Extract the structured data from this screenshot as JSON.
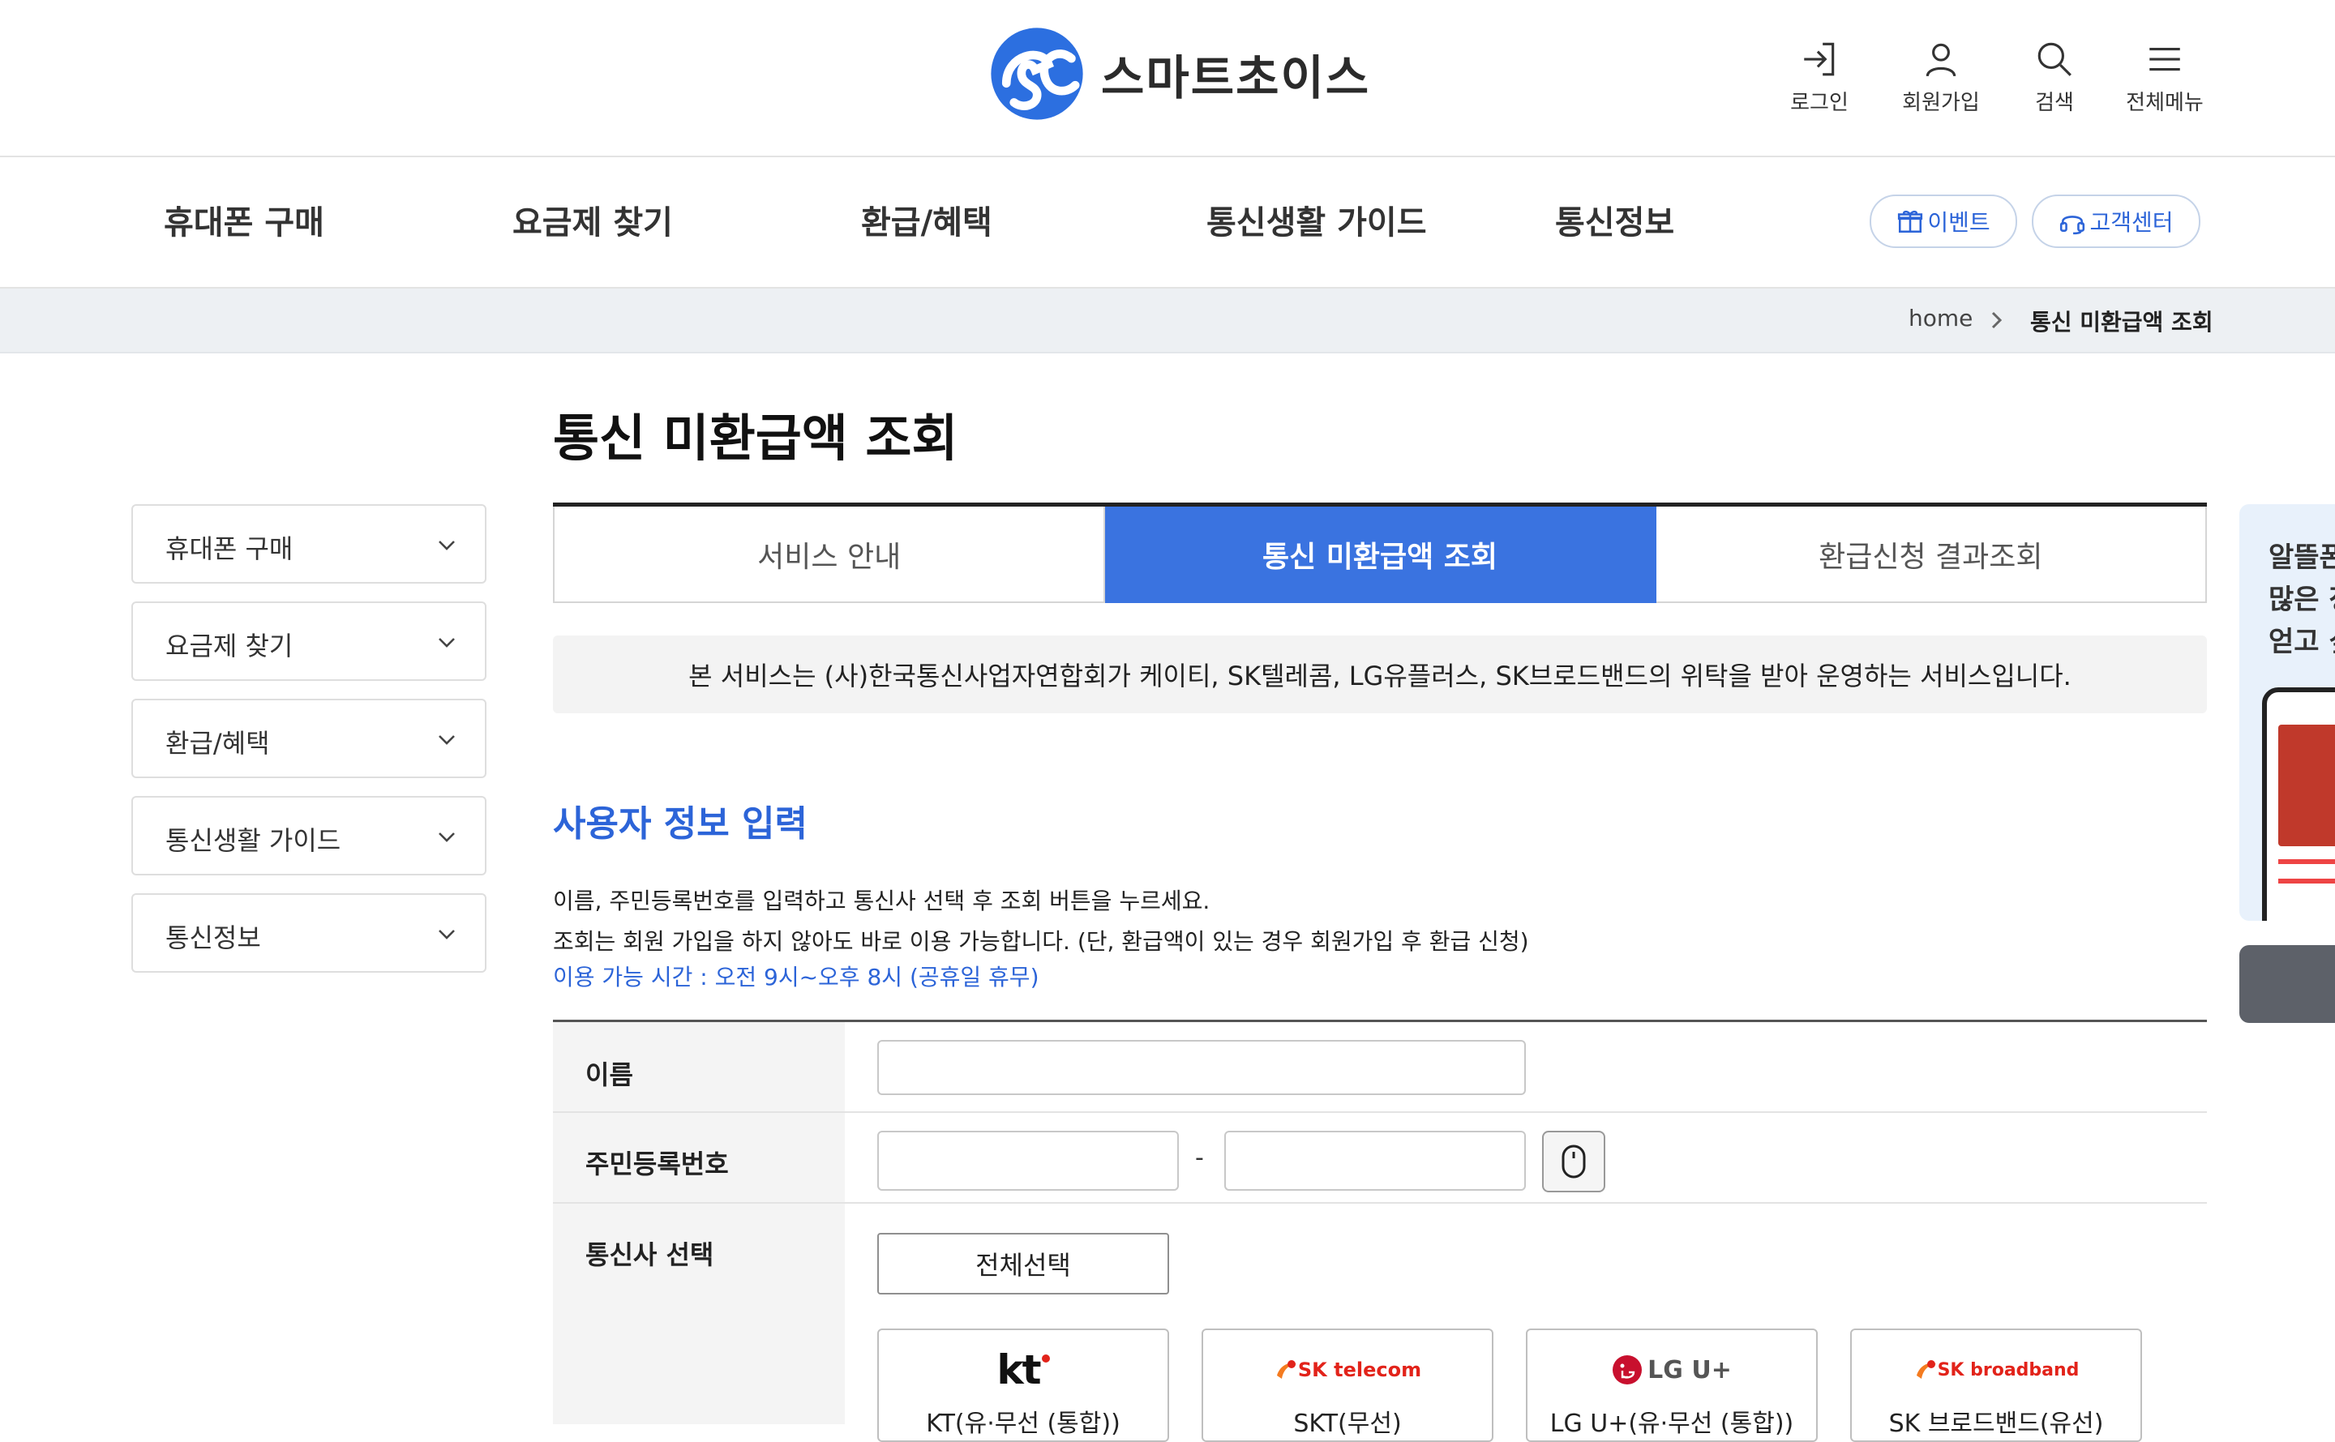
{
  "header": {
    "brand": "스마트초이스",
    "brand_colors": {
      "blue": "#2c6fe0",
      "dark_blue": "#1d4fb8"
    },
    "utility": [
      {
        "icon": "login-icon",
        "label": "로그인"
      },
      {
        "icon": "user-icon",
        "label": "회원가입"
      },
      {
        "icon": "search-icon",
        "label": "검색"
      },
      {
        "icon": "menu-icon",
        "label": "전체메뉴"
      }
    ]
  },
  "gnb": {
    "items": [
      "휴대폰 구매",
      "요금제 찾기",
      "환급/혜택",
      "통신생활 가이드",
      "통신정보"
    ],
    "event_label": "이벤트",
    "cs_label": "고객센터"
  },
  "breadcrumb": {
    "home": "home",
    "current": "통신 미환급액 조회"
  },
  "sidebar": {
    "items": [
      "휴대폰 구매",
      "요금제 찾기",
      "환급/혜택",
      "통신생활 가이드",
      "통신정보"
    ]
  },
  "main": {
    "title": "통신 미환급액 조회",
    "tabs": [
      "서비스 안내",
      "통신 미환급액 조회",
      "환급신청 결과조회"
    ],
    "active_tab": 1,
    "notice": "본 서비스는 (사)한국통신사업자연합회가 케이티, SK텔레콤, LG유플러스, SK브로드밴드의 위탁을 받아 운영하는 서비스입니다.",
    "section_title": "사용자 정보 입력",
    "desc1": "이름, 주민등록번호를 입력하고 통신사 선택 후 조회 버튼을 누르세요.",
    "desc2": "조회는 회원 가입을 하지 않아도 바로 이용 가능합니다. (단, 환급액이 있는 경우 회원가입 후 환급 신청)",
    "hours": "이용 가능 시간 : 오전 9시~오후 8시 (공휴일 휴무)"
  },
  "form": {
    "name_label": "이름",
    "rrn_label": "주민등록번호",
    "rrn_dash": "-",
    "carrier_label": "통신사 선택",
    "select_all": "전체선택",
    "carriers": [
      {
        "logo_text": "kt",
        "name": "KT(유·무선 (통합))"
      },
      {
        "logo_text": "SK telecom",
        "name": "SKT(무선)"
      },
      {
        "logo_text": "LG U+",
        "name": "LG U+(유·무선 (통합))"
      },
      {
        "logo_text": "SK broadband",
        "name": "SK 브로드밴드(유선)"
      }
    ]
  },
  "banner": {
    "lines": [
      "알뜰폰",
      "많은 정",
      "얻고 싶"
    ]
  }
}
